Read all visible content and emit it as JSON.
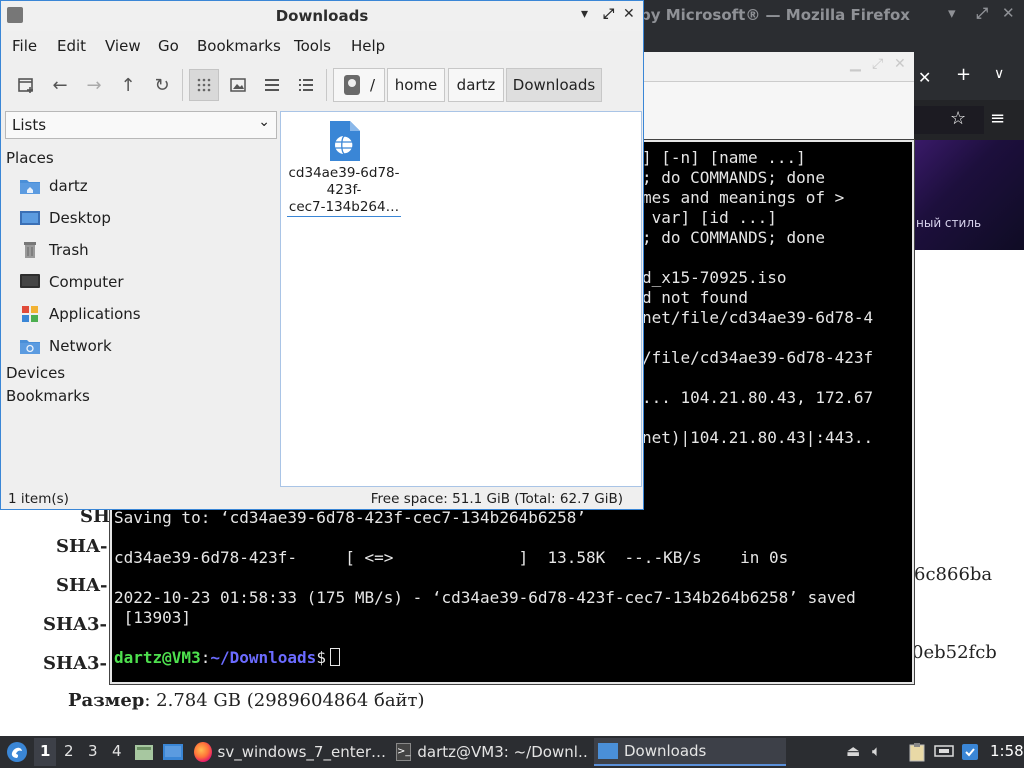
{
  "firefox": {
    "title": "by Microsoft® — Mozilla Firefox",
    "banner_text": "ный стиль",
    "hash_rows": [
      {
        "label": "SH",
        "value": ""
      },
      {
        "label": "SHA-",
        "value": ""
      },
      {
        "label": "SHA-",
        "value": "6c866ba"
      },
      {
        "label": "SHA3-",
        "value": ""
      },
      {
        "label": "SHA3-",
        "value": "0eb52fcb"
      }
    ],
    "size_label": "Размер",
    "size_value": ": 2.784 GB (2989604864 байт)"
  },
  "terminal": {
    "lines": [
      "] [-n] [name ...]",
      "; do COMMANDS; done",
      "mes and meanings of >",
      " var] [id ...]",
      "; do COMMANDS; done",
      "",
      "d_x15-70925.iso",
      "d not found",
      "net/file/cd34ae39-6d78-4",
      "",
      "/file/cd34ae39-6d78-423f",
      "",
      "... 104.21.80.43, 172.67",
      "",
      "net)|104.21.80.43|:443..",
      "",
      "",
      "",
      "Saving to: ‘cd34ae39-6d78-423f-cec7-134b264b6258’",
      "",
      "cd34ae39-6d78-423f-     [ <=>             ]  13.58K  --.-KB/s    in 0s",
      "",
      "2022-10-23 01:58:33 (175 MB/s) - ‘cd34ae39-6d78-423f-cec7-134b264b6258’ saved",
      " [13903]",
      ""
    ],
    "prompt_user": "dartz@VM3",
    "prompt_sep": ":",
    "prompt_path": "~/Downloads",
    "prompt_symbol": "$"
  },
  "file_manager": {
    "title": "Downloads",
    "menu": [
      "File",
      "Edit",
      "View",
      "Go",
      "Bookmarks",
      "Tools",
      "Help"
    ],
    "breadcrumb": [
      "/",
      "home",
      "dartz",
      "Downloads"
    ],
    "side_select": "Lists",
    "places_heading": "Places",
    "places": [
      "dartz",
      "Desktop",
      "Trash",
      "Computer",
      "Applications",
      "Network"
    ],
    "devices_heading": "Devices",
    "bookmarks_heading": "Bookmarks",
    "file_name_lines": [
      "cd34ae39-6d78-",
      "423f-",
      "cec7-134b264…"
    ],
    "status_left": "1 item(s)",
    "status_right": "Free space: 51.1 GiB (Total: 62.7 GiB)"
  },
  "taskbar": {
    "workspaces": [
      "1",
      "2",
      "3",
      "4"
    ],
    "tasks": [
      {
        "label": "sv_windows_7_enter…"
      },
      {
        "label": "dartz@VM3: ~/Downl…"
      },
      {
        "label": "Downloads"
      }
    ],
    "clock": "1:58"
  },
  "colors": {
    "accent": "#3a86d6",
    "terminal_user": "#4ee04e",
    "terminal_path": "#6b6bff",
    "panel": "#2b2d31"
  }
}
